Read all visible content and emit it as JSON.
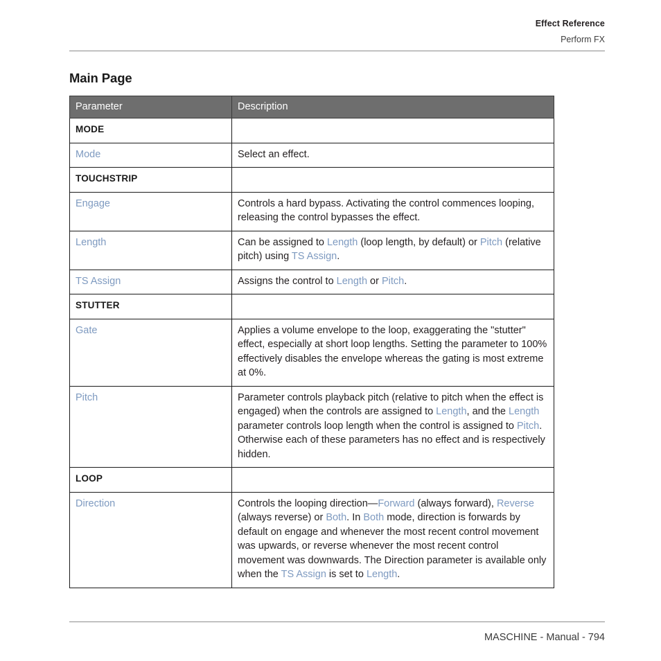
{
  "header": {
    "title": "Effect Reference",
    "subtitle": "Perform FX"
  },
  "page_title": "Main Page",
  "table": {
    "columns": [
      "Parameter",
      "Description"
    ],
    "rows": [
      {
        "type": "section",
        "name": "MODE",
        "description": ""
      },
      {
        "type": "param",
        "name": "Mode",
        "description": "Select an effect."
      },
      {
        "type": "section",
        "name": "TOUCHSTRIP",
        "description": ""
      },
      {
        "type": "param",
        "name": "Engage",
        "description": "Controls a hard bypass. Activating the control commences looping, releasing the control bypasses the effect."
      },
      {
        "type": "param",
        "name": "Length",
        "description": "Can be assigned to Length (loop length, by default) or Pitch (relative pitch) using TS Assign."
      },
      {
        "type": "param",
        "name": "TS Assign",
        "description": "Assigns the control to Length or Pitch."
      },
      {
        "type": "section",
        "name": "STUTTER",
        "description": ""
      },
      {
        "type": "param",
        "name": "Gate",
        "description": "Applies a volume envelope to the loop, exaggerating the \"stutter\" effect, especially at short loop lengths. Setting the parameter to 100% effectively disables the envelope whereas the gating is most extreme at 0%."
      },
      {
        "type": "param",
        "name": "Pitch",
        "description": "Parameter controls playback pitch (relative to pitch when the effect is engaged) when the controls are assigned to Length, and the Length parameter controls loop length when the control is assigned to Pitch. Otherwise each of these parameters has no effect and is respectively hidden."
      },
      {
        "type": "section",
        "name": "LOOP",
        "description": ""
      },
      {
        "type": "param",
        "name": "Direction",
        "description": "Controls the looping direction—Forward (always forward), Reverse (always reverse) or Both. In Both mode, direction is forwards by default on engage and whenever the most recent control movement was upwards, or reverse whenever the most recent control movement was downwards. The Direction parameter is available only when the TS Assign is set to Length."
      }
    ],
    "link_terms": [
      "TS Assign",
      "Length",
      "Pitch",
      "Forward",
      "Reverse",
      "Both"
    ]
  },
  "footer": {
    "text": "MASCHINE - Manual - 794"
  },
  "colors": {
    "link": "#7e9ac0",
    "header_bg": "#6e6e6e",
    "text": "#231f20",
    "rule": "#8c8c8c"
  }
}
